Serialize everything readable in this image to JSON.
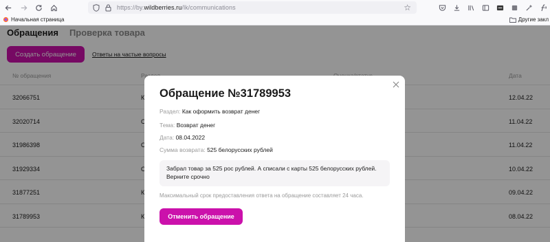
{
  "browser": {
    "url_prefix": "https://by.",
    "url_domain": "wildberries.ru",
    "url_path": "/lk/communications",
    "bookmark_home": "Начальная страница",
    "bookmark_other": "Другие закл"
  },
  "page": {
    "tabs": [
      "Обращения",
      "Проверка товара"
    ],
    "create_button": "Создать обращение",
    "faq_link": "Ответы на частые вопросы",
    "table": {
      "headers": [
        "№ обращения",
        "Раздел",
        "Оценка/статус",
        "Дата"
      ],
      "rows": [
        {
          "id": "32066751",
          "section": "К",
          "date": "12.04.22"
        },
        {
          "id": "32020714",
          "section": "С",
          "date": "11.04.22"
        },
        {
          "id": "31986398",
          "section": "С",
          "date": "11.04.22"
        },
        {
          "id": "31929334",
          "section": "С",
          "date": "10.04.22"
        },
        {
          "id": "31877251",
          "section": "К",
          "date": "09.04.22"
        },
        {
          "id": "31789953",
          "section": "К",
          "date": "08.04.22"
        }
      ]
    }
  },
  "modal": {
    "title": "Обращение №31789953",
    "section_label": "Раздел:",
    "section_value": "Как оформить возврат денег",
    "topic_label": "Тема:",
    "topic_value": "Возврат денег",
    "date_label": "Дата:",
    "date_value": "08.04.2022",
    "amount_label": "Сумма возврата:",
    "amount_value": "525 белорусских рублей",
    "message": "Забрал товар за 525 рос рублей. А списали с карты 525 белорусских рублей. Верните срочно",
    "note": "Максимальный срок предоставления ответа на обращение составляет 24 часа.",
    "cancel_button": "Отменить обращение"
  },
  "colors": {
    "accent": "#cb11ab",
    "overlay": "rgba(0,0,0,0.42)"
  }
}
